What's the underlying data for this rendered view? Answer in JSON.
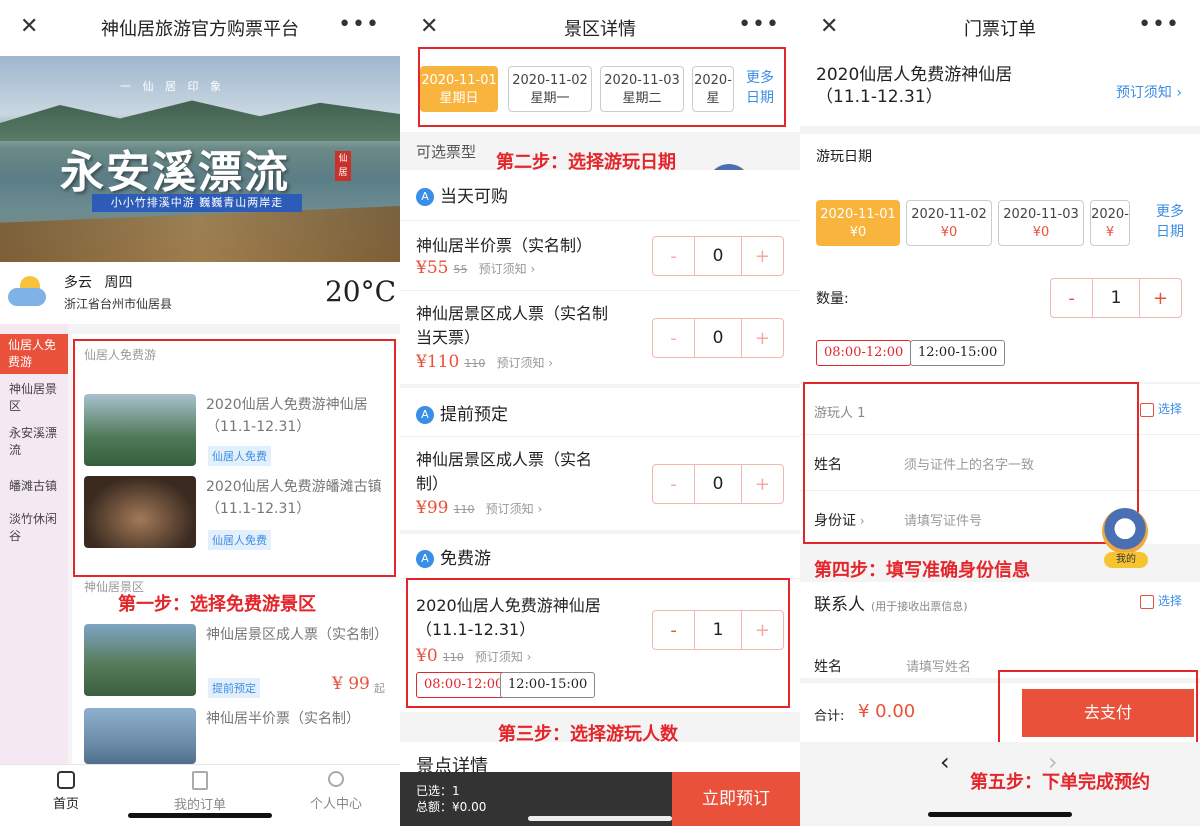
{
  "panel1": {
    "title": "神仙居旅游官方购票平台",
    "banner_title": "永安溪漂流",
    "banner_top": "一 仙 居 印 象",
    "banner_sub": "小小竹排溪中游 巍巍青山两岸走",
    "banner_seal": "仙居",
    "weather": {
      "condition": "多云",
      "weekday": "周四",
      "location": "浙江省台州市仙居县",
      "temp": "20°C"
    },
    "sidebar": [
      "仙居人免费游",
      "神仙居景区",
      "永安溪漂流",
      "皤滩古镇",
      "淡竹休闲谷"
    ],
    "section1_label": "仙居人免费游",
    "item1": {
      "name": "2020仙居人免费游神仙居（11.1-12.31）",
      "tag": "仙居人免费"
    },
    "item2": {
      "name": "2020仙居人免费游皤滩古镇（11.1-12.31）",
      "tag": "仙居人免费"
    },
    "section2_label": "神仙居景区",
    "item3": {
      "name": "神仙居景区成人票（实名制）",
      "tag": "提前预定",
      "price": "¥ 99",
      "suffix": "起"
    },
    "item4": {
      "name": "神仙居半价票（实名制）"
    },
    "step_text": "第一步：选择免费游景区",
    "nav": [
      "首页",
      "我的订单",
      "个人中心"
    ]
  },
  "panel2": {
    "title": "景区详情",
    "dates": [
      {
        "date": "2020-11-01",
        "day": "星期日"
      },
      {
        "date": "2020-11-02",
        "day": "星期一"
      },
      {
        "date": "2020-11-03",
        "day": "星期二"
      },
      {
        "date": "2020-",
        "day": "星"
      }
    ],
    "more_dates": "更多日期",
    "ticket_type_label": "可选票型",
    "step2_text": "第二步：选择游玩日期",
    "avatar_label": "我的",
    "group1": "当天可购",
    "ticket1": {
      "name": "神仙居半价票（实名制）",
      "price": "¥55",
      "orig": "55",
      "notice": "预订须知",
      "qty": "0"
    },
    "ticket2": {
      "name1": "神仙居景区成人票（实名制",
      "name2": "当天票）",
      "price": "¥110",
      "orig": "110",
      "notice": "预订须知",
      "qty": "0"
    },
    "group2": "提前预定",
    "ticket3": {
      "name1": "神仙居景区成人票（实名",
      "name2": "制）",
      "price": "¥99",
      "orig": "110",
      "notice": "预订须知",
      "qty": "0"
    },
    "group3": "免费游",
    "ticket4": {
      "name1": "2020仙居人免费游神仙居",
      "name2": "（11.1-12.31）",
      "price": "¥0",
      "orig": "110",
      "notice": "预订须知",
      "qty": "1"
    },
    "times": [
      "08:00-12:00",
      "12:00-15:00"
    ],
    "step3_text": "第三步：选择游玩人数",
    "detail_label": "景点详情",
    "selected": "已选：1",
    "total": "总额：¥0.00",
    "book": "立即预订"
  },
  "panel3": {
    "title": "门票订单",
    "product1": "2020仙居人免费游神仙居",
    "product2": "（11.1-12.31）",
    "notice": "预订须知",
    "date_label": "游玩日期",
    "dates": [
      {
        "date": "2020-11-01",
        "price": "¥0"
      },
      {
        "date": "2020-11-02",
        "price": "¥0"
      },
      {
        "date": "2020-11-03",
        "price": "¥0"
      },
      {
        "date": "2020-",
        "price": "¥"
      }
    ],
    "more_dates": "更多日期",
    "qty_label": "数量:",
    "qty": "1",
    "times": [
      "08:00-12:00",
      "12:00-15:00"
    ],
    "traveler": "游玩人 1",
    "choose": "选择",
    "name_label": "姓名",
    "name_ph": "须与证件上的名字一致",
    "id_label": "身份证",
    "id_ph": "请填写证件号",
    "avatar_label": "我的",
    "step4_text": "第四步：填写准确身份信息",
    "contact_label": "联系人",
    "contact_hint": "(用于接收出票信息)",
    "contact_choose": "选择",
    "contact_name_label": "姓名",
    "contact_name_ph": "请填写姓名",
    "total_label": "合计:",
    "total_value": "¥ 0.00",
    "pay": "去支付",
    "step5_text": "第五步：下单完成预约"
  },
  "colors": {
    "accent": "#e9513b",
    "step_red": "#e4262b",
    "date_selected": "#f8b43c",
    "link_blue": "#3a8ee6"
  }
}
